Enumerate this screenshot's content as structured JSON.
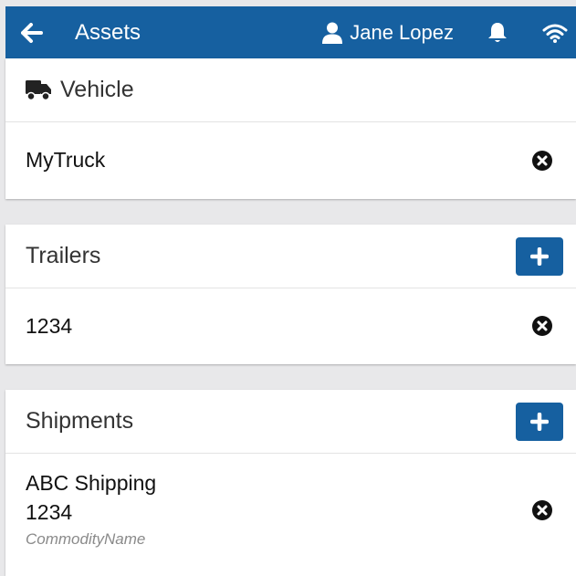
{
  "header": {
    "title": "Assets",
    "user_name": "Jane Lopez",
    "bg_color": "#1660a0",
    "icons": [
      "back-arrow-icon",
      "user-icon",
      "bell-icon",
      "wifi-icon"
    ]
  },
  "vehicle": {
    "heading": "Vehicle",
    "heading_icon": "truck-icon",
    "items": [
      {
        "label": "MyTruck"
      }
    ]
  },
  "trailers": {
    "heading": "Trailers",
    "items": [
      {
        "label": "1234"
      }
    ]
  },
  "shipments": {
    "heading": "Shipments",
    "items": [
      {
        "name": "ABC Shipping",
        "number": "1234",
        "commodity": "CommodityName"
      }
    ]
  }
}
